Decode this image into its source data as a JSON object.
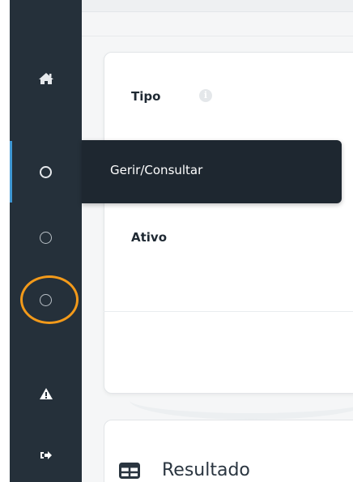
{
  "sidebar": {
    "items": [
      {
        "name": "home",
        "icon": "home-icon"
      },
      {
        "name": "gerir-consultar",
        "icon": "circle-icon",
        "active": true
      },
      {
        "name": "item-3",
        "icon": "circle-icon"
      },
      {
        "name": "item-4",
        "icon": "circle-icon",
        "highlighted": true
      },
      {
        "name": "warning",
        "icon": "warning-icon"
      },
      {
        "name": "logout",
        "icon": "sign-out-icon"
      }
    ]
  },
  "tooltip": {
    "label": "Gerir/Consultar"
  },
  "form": {
    "tipo_label": "Tipo",
    "ativo_label": "Ativo"
  },
  "result": {
    "title": "Resultado",
    "icon": "table-icon"
  },
  "colors": {
    "sidebar_bg": "#25303a",
    "active_indicator": "#3f97d3",
    "highlight_ring": "#f39a1a",
    "tooltip_bg": "#1e2730"
  }
}
